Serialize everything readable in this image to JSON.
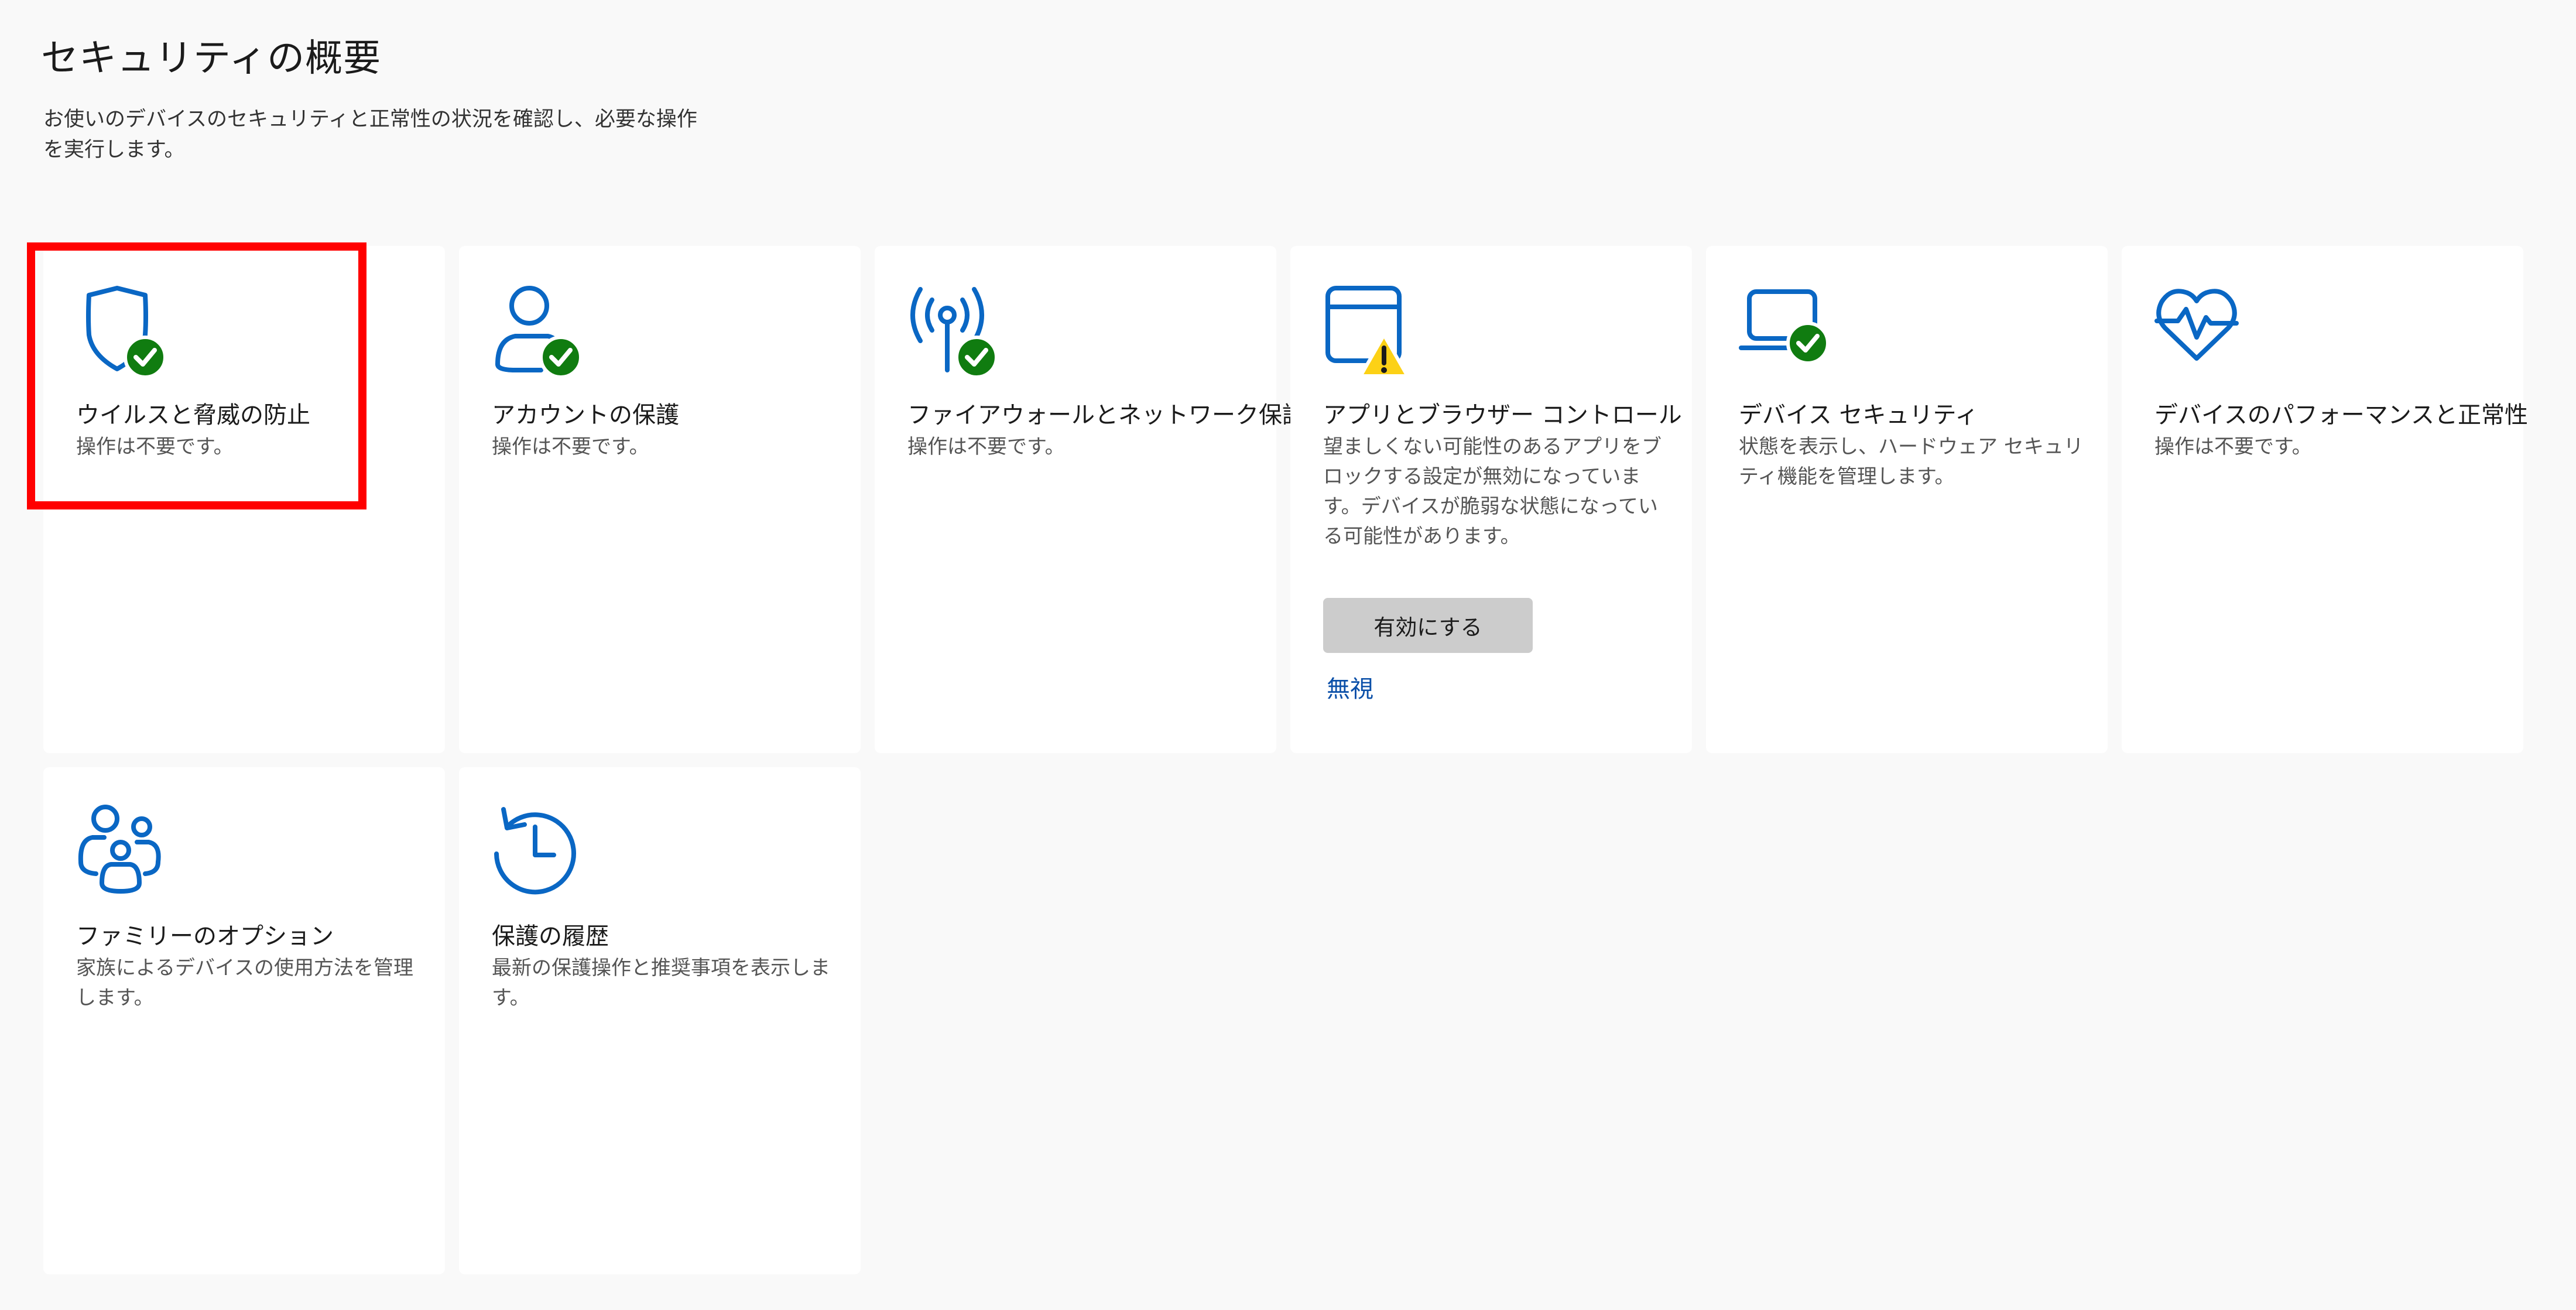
{
  "page": {
    "title": "セキュリティの概要",
    "description": "お使いのデバイスのセキュリティと正常性の状況を確認し、必要な操作を実行します。"
  },
  "colors": {
    "accent": "#0a67c4",
    "ok": "#107c10",
    "warning": "#fcd116",
    "highlight": "#ff0000"
  },
  "cards": [
    {
      "title": "ウイルスと脅威の防止",
      "desc": "操作は不要です。",
      "icon": "shield-check-icon",
      "status": "ok"
    },
    {
      "title": "アカウントの保護",
      "desc": "操作は不要です。",
      "icon": "person-check-icon",
      "status": "ok"
    },
    {
      "title": "ファイアウォールとネットワーク保護",
      "desc": "操作は不要です。",
      "icon": "antenna-check-icon",
      "status": "ok"
    },
    {
      "title": "アプリとブラウザー コントロール",
      "desc": "望ましくない可能性のあるアプリをブロックする設定が無効になっています。デバイスが脆弱な状態になっている可能性があります。",
      "icon": "app-window-warning-icon",
      "status": "warning",
      "button": "有効にする",
      "link": "無視"
    },
    {
      "title": "デバイス セキュリティ",
      "desc": "状態を表示し、ハードウェア セキュリティ機能を管理します。",
      "icon": "laptop-check-icon",
      "status": "ok"
    },
    {
      "title": "デバイスのパフォーマンスと正常性",
      "desc": "操作は不要です。",
      "icon": "heart-pulse-icon",
      "status": "ok"
    },
    {
      "title": "ファミリーのオプション",
      "desc": "家族によるデバイスの使用方法を管理します。",
      "icon": "family-icon",
      "status": "none"
    },
    {
      "title": "保護の履歴",
      "desc": "最新の保護操作と推奨事項を表示します。",
      "icon": "history-clock-icon",
      "status": "none"
    }
  ]
}
